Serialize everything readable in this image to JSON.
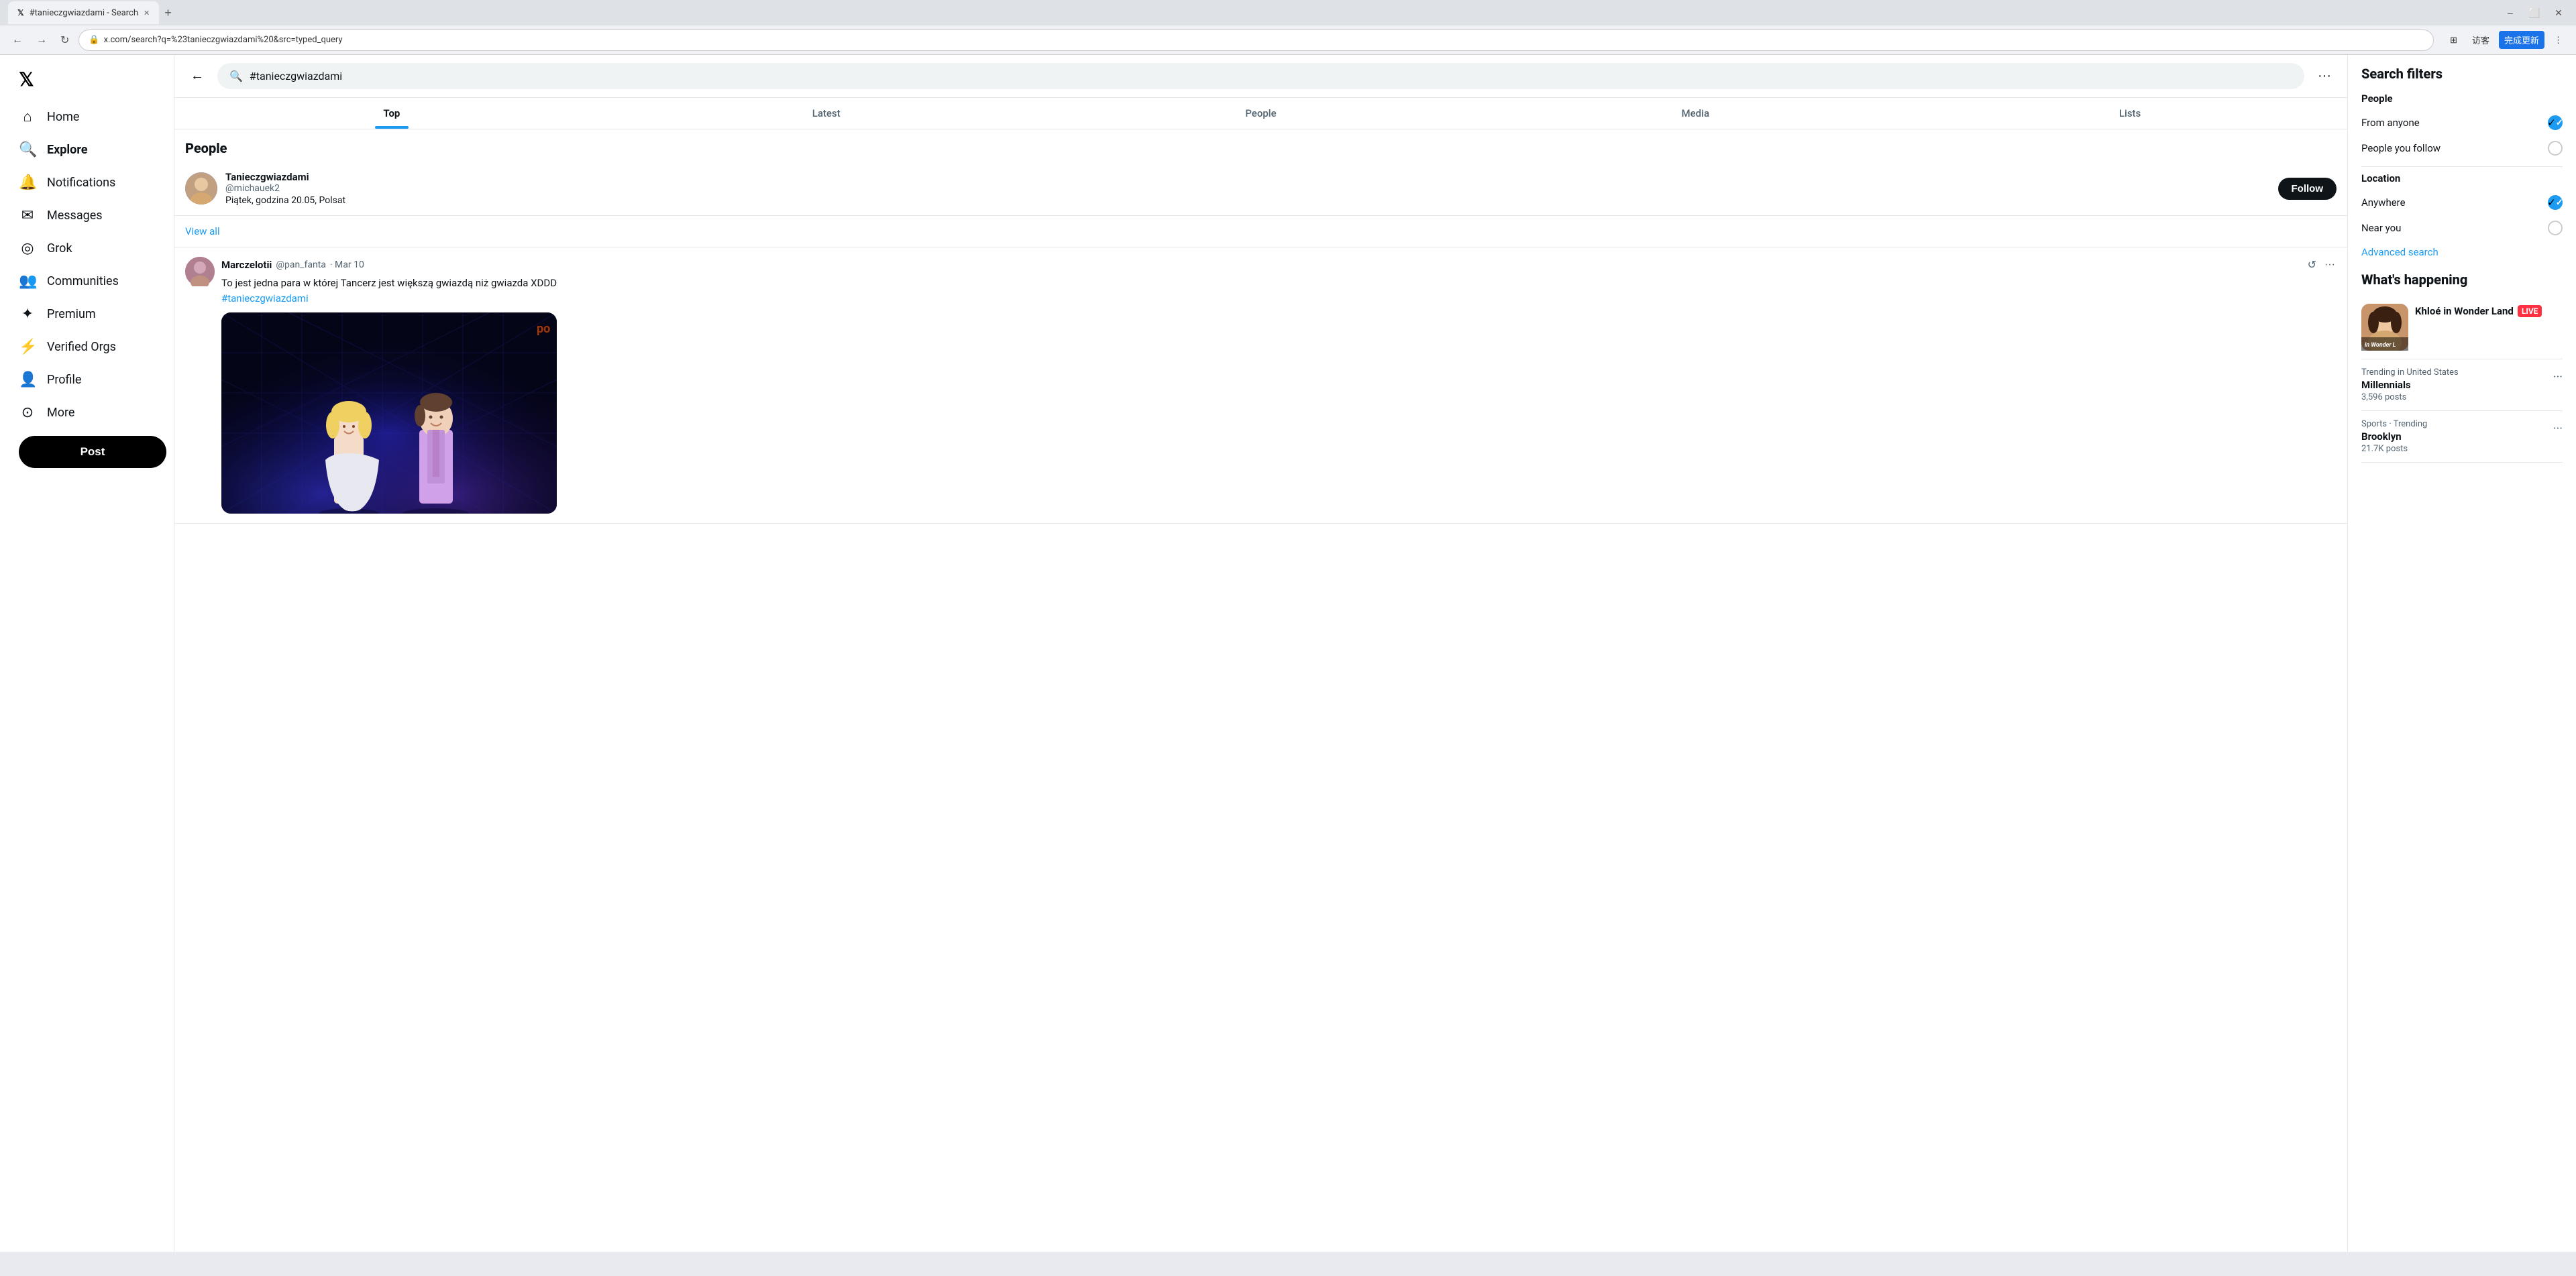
{
  "browser": {
    "tab_title": "#tanieczgwiazdami - Search",
    "new_tab_label": "+",
    "url": "x.com/search?q=%23tanieczgwiazdami%20&src=typed_query",
    "back_label": "←",
    "forward_label": "→",
    "refresh_label": "↻",
    "translate_btn": "⊞",
    "visitor_label": "访客",
    "complete_update_label": "完成更新",
    "more_label": "⋮",
    "minimize_label": "–",
    "maximize_label": "⬜",
    "close_label": "✕"
  },
  "sidebar": {
    "logo": "𝕏",
    "items": [
      {
        "id": "home",
        "label": "Home",
        "icon": "⌂"
      },
      {
        "id": "explore",
        "label": "Explore",
        "icon": "🔍"
      },
      {
        "id": "notifications",
        "label": "Notifications",
        "icon": "🔔"
      },
      {
        "id": "messages",
        "label": "Messages",
        "icon": "✉"
      },
      {
        "id": "grok",
        "label": "Grok",
        "icon": "◎"
      },
      {
        "id": "communities",
        "label": "Communities",
        "icon": "👥"
      },
      {
        "id": "premium",
        "label": "Premium",
        "icon": "✦"
      },
      {
        "id": "verified_orgs",
        "label": "Verified Orgs",
        "icon": "⚡"
      },
      {
        "id": "profile",
        "label": "Profile",
        "icon": "👤"
      },
      {
        "id": "more",
        "label": "More",
        "icon": "⊙"
      }
    ],
    "post_label": "Post"
  },
  "search": {
    "query": "#tanieczgwiazdami",
    "back_icon": "←",
    "more_icon": "···"
  },
  "tabs": [
    {
      "id": "top",
      "label": "Top",
      "active": true
    },
    {
      "id": "latest",
      "label": "Latest",
      "active": false
    },
    {
      "id": "people",
      "label": "People",
      "active": false
    },
    {
      "id": "media",
      "label": "Media",
      "active": false
    },
    {
      "id": "lists",
      "label": "Lists",
      "active": false
    }
  ],
  "people_section": {
    "title": "People",
    "person": {
      "name": "Tanieczgwiazdami",
      "handle": "@michauek2",
      "bio": "Piątek, godzina 20.05, Polsat",
      "follow_label": "Follow"
    },
    "view_all_label": "View all"
  },
  "tweet": {
    "author_name": "Marczelotii",
    "author_handle": "@pan_fanta",
    "date": "· Mar 10",
    "text": "To jest jedna para w której Tancerz jest większą gwiazdą niż gwiazda XDDD",
    "hashtag": "#tanieczgwiazdami",
    "retweet_icon": "↺",
    "more_icon": "···"
  },
  "right_sidebar": {
    "filter_title": "Search filters",
    "people_section_label": "People",
    "from_anyone_label": "From anyone",
    "from_anyone_checked": true,
    "people_you_follow_label": "People you follow",
    "people_you_follow_checked": false,
    "location_section_label": "Location",
    "anywhere_label": "Anywhere",
    "anywhere_checked": true,
    "near_you_label": "Near you",
    "near_you_checked": false,
    "advanced_search_label": "Advanced search",
    "whats_happening_title": "What's happening",
    "trending": [
      {
        "type": "image",
        "category": "",
        "name": "Khloé in Wonder Land",
        "sub": "LIVE",
        "count": ""
      },
      {
        "type": "simple",
        "category": "Trending in United States",
        "name": "Millennials",
        "count": "3,596 posts"
      },
      {
        "type": "simple",
        "category": "Sports · Trending",
        "name": "Brooklyn",
        "count": "21.7K posts"
      }
    ]
  }
}
